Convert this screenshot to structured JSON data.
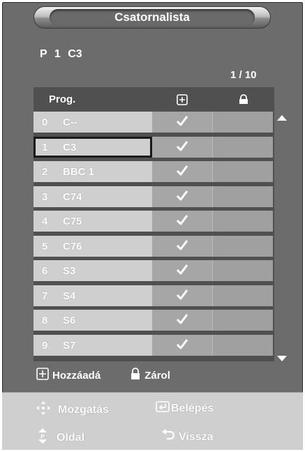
{
  "title": "Csatornalista",
  "current_program": {
    "label": "P",
    "number": "1",
    "name": "C3"
  },
  "page_indicator": "1 / 10",
  "table": {
    "header_prog": "Prog.",
    "add_icon": "add-box-icon",
    "lock_icon": "lock-icon",
    "rows": [
      {
        "num": "0",
        "name": "C--",
        "added": true
      },
      {
        "num": "1",
        "name": "C3",
        "added": true,
        "selected": true
      },
      {
        "num": "2",
        "name": "BBC 1",
        "added": true
      },
      {
        "num": "3",
        "name": "C74",
        "added": true
      },
      {
        "num": "4",
        "name": "C75",
        "added": true
      },
      {
        "num": "5",
        "name": "C76",
        "added": true
      },
      {
        "num": "6",
        "name": "S3",
        "added": true
      },
      {
        "num": "7",
        "name": "S4",
        "added": true
      },
      {
        "num": "8",
        "name": "S6",
        "added": true
      },
      {
        "num": "9",
        "name": "S7",
        "added": true
      }
    ]
  },
  "legend": {
    "add_label": "Hozzáadá",
    "lock_label": "Zárol"
  },
  "footer": {
    "move_label": "Mozgatás",
    "enter_label": "Belépés",
    "page_label": "Oldal",
    "return_label": "Vissza"
  },
  "colors": {
    "background": "#6c6c6c",
    "row_name": "#cfcfcf",
    "row_add": "#a6a6a6",
    "footer": "#cfcfcf"
  }
}
